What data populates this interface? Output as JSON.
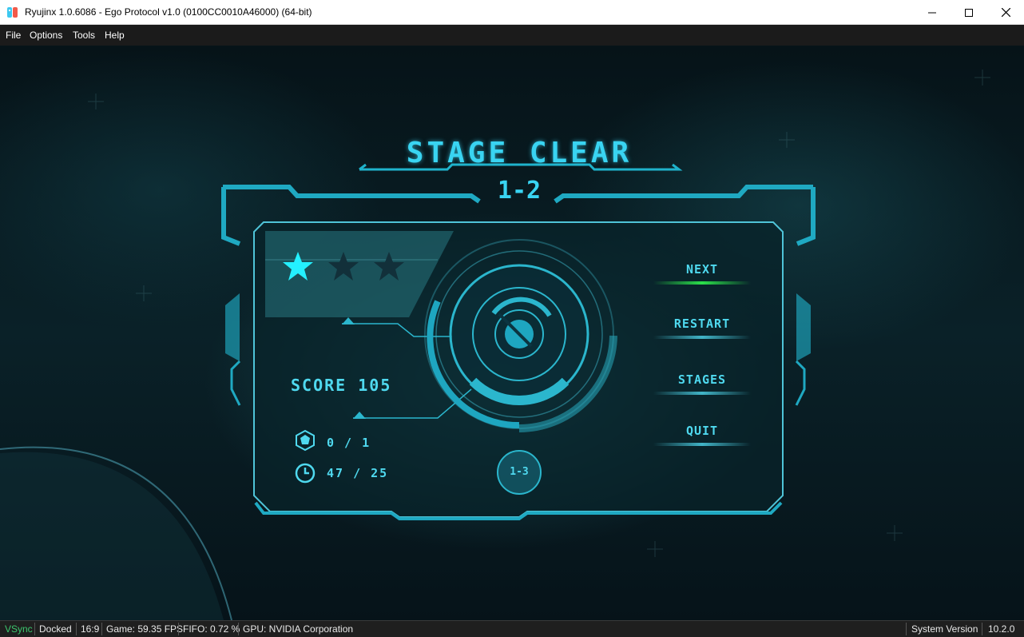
{
  "window": {
    "title": "Ryujinx 1.0.6086 - Ego Protocol v1.0 (0100CC0010A46000) (64-bit)",
    "controls": {
      "minimize_icon": "minimize-icon",
      "maximize_icon": "maximize-icon",
      "close_icon": "close-icon"
    }
  },
  "menu": {
    "file": "File",
    "options": "Options",
    "tools": "Tools",
    "help": "Help"
  },
  "game": {
    "title": "STAGE CLEAR",
    "level": "1-2",
    "stars": {
      "earned": 1,
      "total": 3
    },
    "score": "SCORE 105",
    "collectibles": "0 / 1",
    "time": "47 / 25",
    "next_level_badge": "1-3",
    "buttons": {
      "next": "NEXT",
      "restart": "RESTART",
      "stages": "STAGES",
      "quit": "QUIT"
    },
    "selected_button": "NEXT",
    "accent": "#39d4f2",
    "selected_color": "#2be04a"
  },
  "status": {
    "vsync": "VSync",
    "dock": "Docked",
    "aspect": "16:9",
    "game_fps": "Game: 59.35 FPS",
    "fifo": "FIFO: 0.72 %",
    "gpu": "GPU:  NVIDIA Corporation",
    "system_version_label": "System Version",
    "system_version": "10.2.0",
    "vsync_color": "#3cc66e"
  }
}
